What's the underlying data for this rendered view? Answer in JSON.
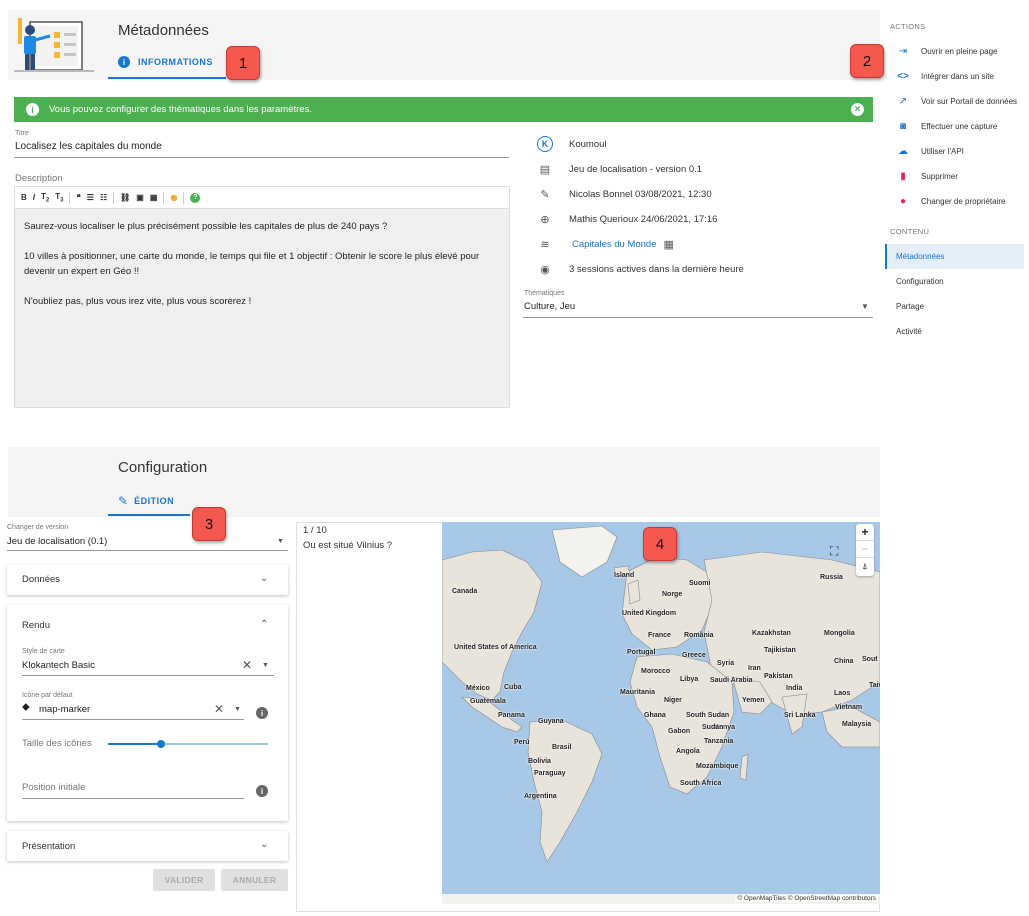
{
  "metadata": {
    "title": "Métadonnées",
    "tab_label": "INFORMATIONS",
    "alert_text": "Vous pouvez configurer des thématiques dans les paramètres.",
    "title_field_label": "Titre",
    "title_field_value": "Localisez les capitales du monde",
    "description_label": "Description",
    "description_paragraphs": [
      "Saurez-vous localiser le plus précisément possible les capitales de plus de 240 pays ?",
      "10 villes à positionner, une carte du monde, le temps qui file et 1 objectif : Obtenir le score le plus élevé pour devenir un expert en Géo !!",
      "N'oubliez pas, plus vous irez vite, plus vous scorerez !"
    ],
    "info": {
      "owner": "Koumoul",
      "application": "Jeu de localisation - version 0.1",
      "updated": "Nicolas Bonnel 03/08/2021, 12:30",
      "created": "Mathis Querioux 24/06/2021, 17:16",
      "dataset": "Capitales du Monde",
      "sessions": "3 sessions actives dans la dernière heure"
    },
    "topics_label": "Thématiques",
    "topics_value": "Culture, Jeu"
  },
  "sidebar": {
    "actions_heading": "ACTIONS",
    "actions": [
      {
        "label": "Ouvrir en pleine page",
        "icon": "open-in-new-icon",
        "color": "#1976d2"
      },
      {
        "label": "Intégrer dans un site",
        "icon": "code-icon",
        "color": "#1976d2"
      },
      {
        "label": "Voir sur Portail de données",
        "icon": "external-link-icon",
        "color": "#1976d2"
      },
      {
        "label": "Effectuer une capture",
        "icon": "camera-icon",
        "color": "#1976d2"
      },
      {
        "label": "Utiliser l'API",
        "icon": "cloud-icon",
        "color": "#1976d2"
      },
      {
        "label": "Supprimer",
        "icon": "trash-icon",
        "color": "#e91e63"
      },
      {
        "label": "Changer de propriétaire",
        "icon": "person-icon",
        "color": "#e91e63"
      }
    ],
    "content_heading": "CONTENU",
    "content_items": [
      "Métadonnées",
      "Configuration",
      "Partage",
      "Activité"
    ]
  },
  "config": {
    "title": "Configuration",
    "tab_label": "ÉDITION",
    "version_label": "Changer de version",
    "version_value": "Jeu de localisation (0.1)",
    "panel_data": "Données",
    "panel_render": "Rendu",
    "map_style_label": "Style de carte",
    "map_style_value": "Klokantech Basic",
    "icon_label": "Icône par défaut",
    "icon_value": "map-marker",
    "icon_size_label": "Taille des icônes",
    "icon_size_value": 0.33,
    "initial_position_label": "Position initiale",
    "panel_presentation": "Présentation",
    "validate_label": "VALIDER",
    "cancel_label": "ANNULER"
  },
  "preview": {
    "counter": "1 / 10",
    "question": "Ou est situé Vilnius ?",
    "zoom_in": "+",
    "zoom_out": "−",
    "attribution": "© OpenMapTiles © OpenStreetMap contributors",
    "labels": [
      "Island",
      "Suomi",
      "Russia",
      "Norge",
      "Canada",
      "United Kingdom",
      "France",
      "România",
      "Kazakhstan",
      "Mongolia",
      "Greece",
      "Tajikistan",
      "United States of America",
      "Portugal",
      "Syria",
      "Iran",
      "China",
      "Sout",
      "Morocco",
      "Pakistan",
      "Taiwa",
      "México",
      "Cuba",
      "Mauritania",
      "Libya",
      "Saudi Arabia",
      "India",
      "Laos",
      "Guatemala",
      "Niger",
      "Yemen",
      "Vietnam",
      "Panama",
      "Guyana",
      "Ghana",
      "South Sudan",
      "Sri Lanka",
      "Malaysia",
      "Gabon",
      "Kenya",
      "Perú",
      "Brasil",
      "Tanzania",
      "Angola",
      "Bolivia",
      "Mozambique",
      "Paraguay",
      "South Africa",
      "Argentina",
      "Sudan"
    ]
  },
  "badges": [
    "1",
    "2",
    "3",
    "4"
  ]
}
